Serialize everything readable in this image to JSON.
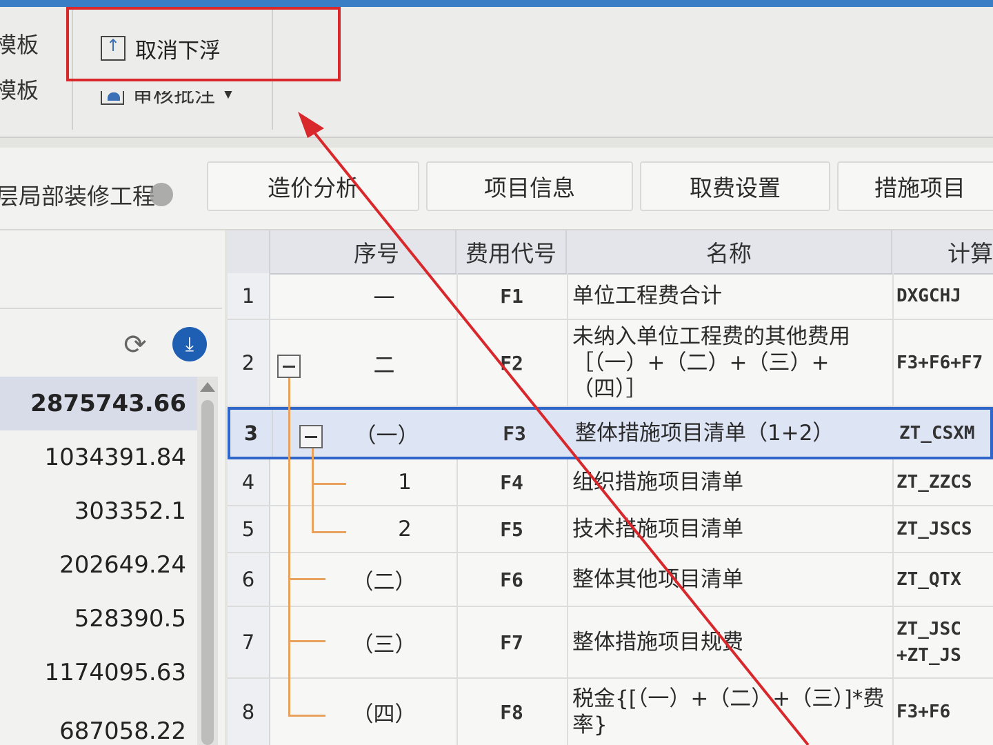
{
  "ribbon": {
    "left_label_1": "模板",
    "left_label_2": "模板",
    "cancel_float_label": "取消下浮",
    "review_label": "审核批注"
  },
  "tabs": {
    "project_tab": "层局部装修工程",
    "items": [
      "造价分析",
      "项目信息",
      "取费设置",
      "措施项目"
    ]
  },
  "left_panel": {
    "values": [
      "2875743.66",
      "1034391.84",
      "303352.1",
      "202649.24",
      "528390.5",
      "1174095.63",
      "687058.22"
    ]
  },
  "grid": {
    "headers": {
      "seq": "序号",
      "code": "费用代号",
      "name": "名称",
      "calc": "计算"
    },
    "rows": [
      {
        "rn": "1",
        "seq": "一",
        "code": "F1",
        "name": "单位工程费合计",
        "calc": "DXGCHJ"
      },
      {
        "rn": "2",
        "seq": "二",
        "code": "F2",
        "name": "未纳入单位工程费的其他费用［（一）+（二）+（三）+（四）］",
        "calc": "F3+F6+F7"
      },
      {
        "rn": "3",
        "seq": "（一）",
        "code": "F3",
        "name": "整体措施项目清单（1+2）",
        "calc": "ZT_CSXM"
      },
      {
        "rn": "4",
        "seq": "1",
        "code": "F4",
        "name": "组织措施项目清单",
        "calc": "ZT_ZZCS"
      },
      {
        "rn": "5",
        "seq": "2",
        "code": "F5",
        "name": "技术措施项目清单",
        "calc": "ZT_JSCS"
      },
      {
        "rn": "6",
        "seq": "（二）",
        "code": "F6",
        "name": "整体其他项目清单",
        "calc": "ZT_QTX"
      },
      {
        "rn": "7",
        "seq": "（三）",
        "code": "F7",
        "name": "整体措施项目规费",
        "calc": "ZT_JSC\n+ZT_JS"
      },
      {
        "rn": "8",
        "seq": "（四）",
        "code": "F8",
        "name": "税金{[（一）+（二）+（三）]*费率}",
        "calc": "F3+F6"
      }
    ]
  },
  "colors": {
    "highlight_box": "#d8282c",
    "selected_row_border": "#2f66c9",
    "tree_line": "#e9a15e",
    "download_icon": "#1f5fb3"
  }
}
